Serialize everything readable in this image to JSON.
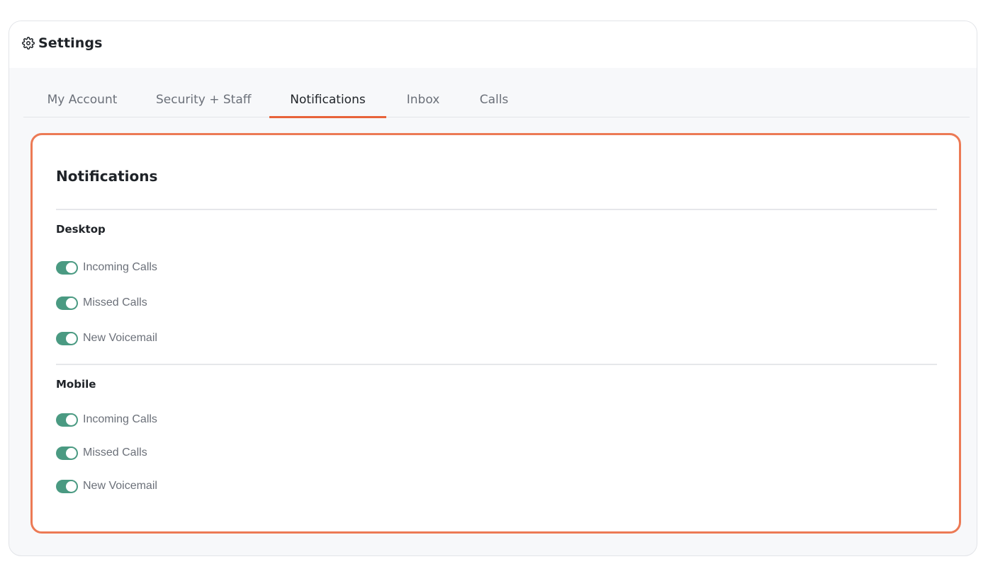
{
  "app": {
    "title": "Settings",
    "icon": "gear-icon"
  },
  "tabs": [
    {
      "label": "My Account",
      "active": false
    },
    {
      "label": "Security + Staff",
      "active": false
    },
    {
      "label": "Notifications",
      "active": true
    },
    {
      "label": "Inbox",
      "active": false
    },
    {
      "label": "Calls",
      "active": false
    }
  ],
  "panel": {
    "title": "Notifications",
    "sections": [
      {
        "label": "Desktop",
        "items": [
          {
            "label": "Incoming Calls",
            "enabled": true
          },
          {
            "label": "Missed Calls",
            "enabled": true
          },
          {
            "label": "New Voicemail",
            "enabled": true
          }
        ]
      },
      {
        "label": "Mobile",
        "items": [
          {
            "label": "Incoming Calls",
            "enabled": true
          },
          {
            "label": "Missed Calls",
            "enabled": true
          },
          {
            "label": "New Voicemail",
            "enabled": true
          }
        ]
      }
    ]
  },
  "colors": {
    "accent": "#e8633a",
    "panel_border": "#ec7a55",
    "toggle_on": "#4a9a82"
  }
}
